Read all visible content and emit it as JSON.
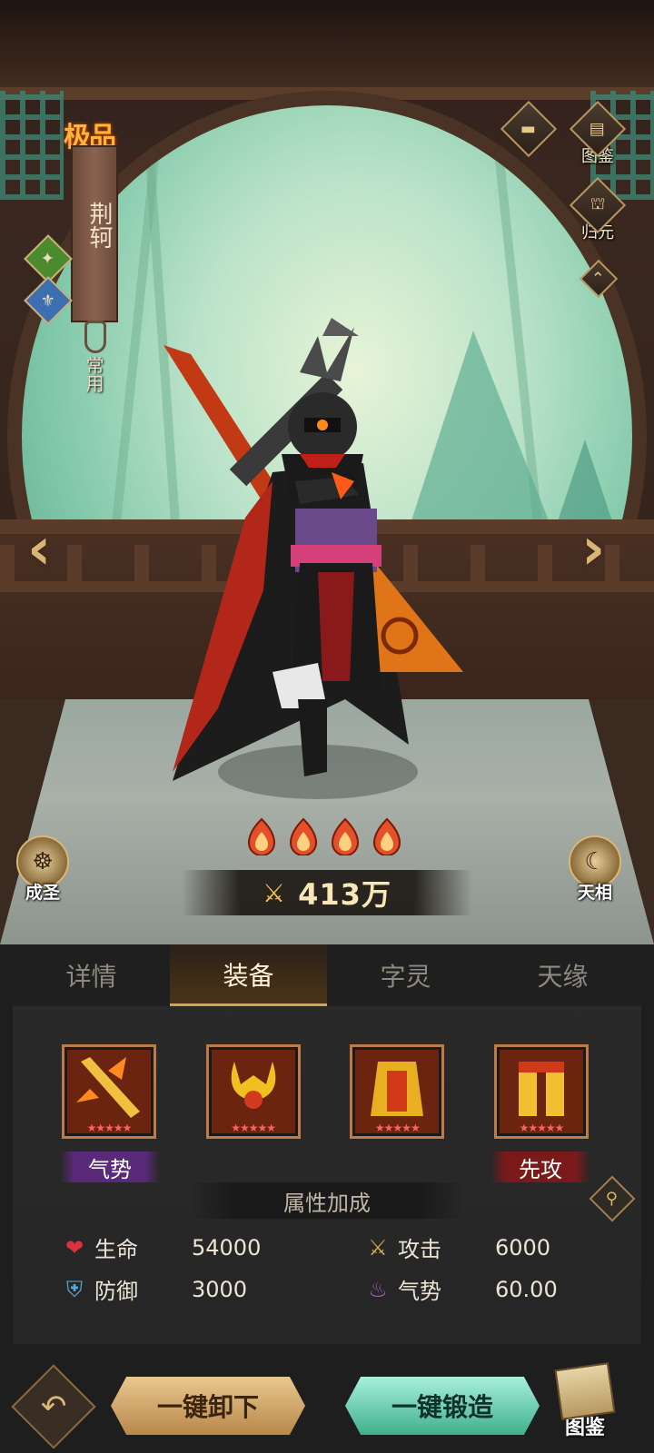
{
  "hero": {
    "grade": "极品",
    "name": "荆轲",
    "common_label": "常用",
    "element_icons": [
      "wind-icon",
      "water-icon"
    ],
    "star_count": 4,
    "power_value": "413万"
  },
  "side_buttons": {
    "codex": "图鉴",
    "return": "归元",
    "saint": "成圣",
    "sky": "天相"
  },
  "tabs": [
    {
      "label": "详情",
      "active": false
    },
    {
      "label": "装备",
      "active": true
    },
    {
      "label": "字灵",
      "active": false
    },
    {
      "label": "天缘",
      "active": false
    }
  ],
  "equipment": [
    {
      "name": "weapon",
      "stars": "★★★★★"
    },
    {
      "name": "helmet",
      "stars": "★★★★★"
    },
    {
      "name": "armor",
      "stars": "★★★★★"
    },
    {
      "name": "boots",
      "stars": "★★★★★"
    }
  ],
  "tags": {
    "momentum": "气势",
    "first_strike": "先攻"
  },
  "attributes": {
    "title": "属性加成",
    "hp": {
      "label": "生命",
      "value": "54000"
    },
    "atk": {
      "label": "攻击",
      "value": "6000"
    },
    "def": {
      "label": "防御",
      "value": "3000"
    },
    "momentum": {
      "label": "气势",
      "value": "60.00"
    }
  },
  "actions": {
    "unload": "一键卸下",
    "forge": "一键锻造",
    "codex": "图鉴"
  },
  "colors": {
    "accent_gold": "#d6a24a",
    "forge_teal": "#3fb08c",
    "flame_red": "#e4502a"
  }
}
